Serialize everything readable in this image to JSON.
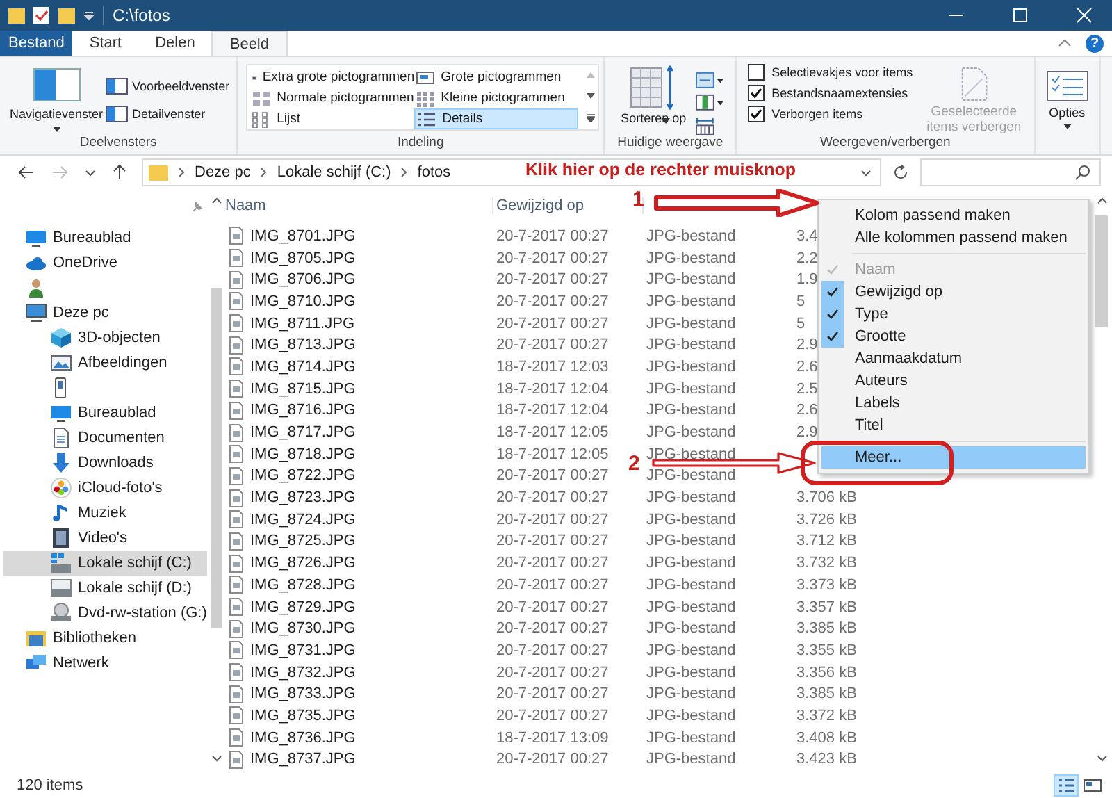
{
  "window": {
    "title": "C:\\fotos"
  },
  "ribbon_tabs": [
    {
      "label": "Bestand",
      "kind": "file",
      "selected": false
    },
    {
      "label": "Start",
      "kind": "tab",
      "selected": false
    },
    {
      "label": "Delen",
      "kind": "tab",
      "selected": false
    },
    {
      "label": "Beeld",
      "kind": "tab",
      "selected": true
    }
  ],
  "help": "?",
  "ribbon": {
    "panes": {
      "label": "Deelvensters",
      "navigation": "Navigatievenster",
      "preview": "Voorbeeldvenster",
      "details": "Detailvenster"
    },
    "layout": {
      "label": "Indeling",
      "options": [
        {
          "label": "Extra grote pictogrammen",
          "kind": "xl",
          "selected": false
        },
        {
          "label": "Grote pictogrammen",
          "kind": "large",
          "selected": false
        },
        {
          "label": "Normale pictogrammen",
          "kind": "medium",
          "selected": false
        },
        {
          "label": "Kleine pictogrammen",
          "kind": "small",
          "selected": false
        },
        {
          "label": "Lijst",
          "kind": "list",
          "selected": false
        },
        {
          "label": "Details",
          "kind": "details",
          "selected": true
        }
      ]
    },
    "current_view": {
      "label": "Huidige weergave",
      "sort": "Sorteren op"
    },
    "show_hide": {
      "label": "Weergeven/verbergen",
      "options": [
        {
          "label": "Selectievakjes voor items",
          "checked": false
        },
        {
          "label": "Bestandsnaamextensies",
          "checked": true
        },
        {
          "label": "Verborgen items",
          "checked": true
        }
      ],
      "hide_selected": {
        "label": "Geselecteerde items verbergen",
        "disabled": true
      }
    },
    "options": "Opties"
  },
  "address": {
    "breadcrumbs": [
      "Deze pc",
      "Lokale schijf (C:)",
      "fotos"
    ]
  },
  "annotation": {
    "instruction": "Klik hier op de rechter muisknop",
    "step_1": "1",
    "step_2": "2"
  },
  "navigation": [
    {
      "kind": "desktop",
      "label": "Bureaublad",
      "selected": false
    },
    {
      "kind": "cloud",
      "label": "OneDrive",
      "selected": false
    },
    {
      "kind": "user",
      "selected": false
    },
    {
      "kind": "pc",
      "label": "Deze pc",
      "selected": false,
      "children": [
        {
          "kind": "cube",
          "label": "3D-objecten",
          "selected": false
        },
        {
          "kind": "pictures",
          "label": "Afbeeldingen",
          "selected": false
        },
        {
          "kind": "phone",
          "selected": false
        },
        {
          "kind": "desktop",
          "label": "Bureaublad",
          "selected": false
        },
        {
          "kind": "documents",
          "label": "Documenten",
          "selected": false
        },
        {
          "kind": "downloads",
          "label": "Downloads",
          "selected": false
        },
        {
          "kind": "photos",
          "label": "iCloud-foto's",
          "selected": false
        },
        {
          "kind": "music",
          "label": "Muziek",
          "selected": false
        },
        {
          "kind": "video",
          "label": "Video's",
          "selected": false
        },
        {
          "kind": "system",
          "label": "Lokale schijf (C:)",
          "selected": true
        },
        {
          "kind": "drive",
          "label": "Lokale schijf (D:)",
          "selected": false
        },
        {
          "kind": "dvd",
          "label": "Dvd-rw-station (G:)",
          "selected": false
        }
      ]
    },
    {
      "kind": "library",
      "label": "Bibliotheken",
      "selected": false
    },
    {
      "kind": "network",
      "label": "Netwerk",
      "selected": false
    }
  ],
  "table": {
    "columns": [
      "Naam",
      "Gewijzigd op"
    ],
    "rows": [
      [
        "IMG_8701.JPG",
        "20-7-2017 00:27",
        "JPG-bestand",
        "3.4"
      ],
      [
        "IMG_8705.JPG",
        "20-7-2017 00:27",
        "JPG-bestand",
        "2.2"
      ],
      [
        "IMG_8706.JPG",
        "20-7-2017 00:27",
        "JPG-bestand",
        "1.9"
      ],
      [
        "IMG_8710.JPG",
        "20-7-2017 00:27",
        "JPG-bestand",
        "5"
      ],
      [
        "IMG_8711.JPG",
        "20-7-2017 00:27",
        "JPG-bestand",
        "5"
      ],
      [
        "IMG_8713.JPG",
        "20-7-2017 00:27",
        "JPG-bestand",
        "2.9"
      ],
      [
        "IMG_8714.JPG",
        "18-7-2017 12:03",
        "JPG-bestand",
        "2.6"
      ],
      [
        "IMG_8715.JPG",
        "18-7-2017 12:04",
        "JPG-bestand",
        "2.5"
      ],
      [
        "IMG_8716.JPG",
        "18-7-2017 12:04",
        "JPG-bestand",
        "2.6"
      ],
      [
        "IMG_8717.JPG",
        "18-7-2017 12:05",
        "JPG-bestand",
        "2.9"
      ],
      [
        "IMG_8718.JPG",
        "18-7-2017 12:05",
        "JPG-bestand"
      ],
      [
        "IMG_8722.JPG",
        "20-7-2017 00:27",
        "JPG-bestand"
      ],
      [
        "IMG_8723.JPG",
        "20-7-2017 00:27",
        "JPG-bestand",
        "3.706 kB"
      ],
      [
        "IMG_8724.JPG",
        "20-7-2017 00:27",
        "JPG-bestand",
        "3.726 kB"
      ],
      [
        "IMG_8725.JPG",
        "20-7-2017 00:27",
        "JPG-bestand",
        "3.712 kB"
      ],
      [
        "IMG_8726.JPG",
        "20-7-2017 00:27",
        "JPG-bestand",
        "3.732 kB"
      ],
      [
        "IMG_8728.JPG",
        "20-7-2017 00:27",
        "JPG-bestand",
        "3.373 kB"
      ],
      [
        "IMG_8729.JPG",
        "20-7-2017 00:27",
        "JPG-bestand",
        "3.357 kB"
      ],
      [
        "IMG_8730.JPG",
        "20-7-2017 00:27",
        "JPG-bestand",
        "3.385 kB"
      ],
      [
        "IMG_8731.JPG",
        "20-7-2017 00:27",
        "JPG-bestand",
        "3.355 kB"
      ],
      [
        "IMG_8732.JPG",
        "20-7-2017 00:27",
        "JPG-bestand",
        "3.356 kB"
      ],
      [
        "IMG_8733.JPG",
        "20-7-2017 00:27",
        "JPG-bestand",
        "3.385 kB"
      ],
      [
        "IMG_8735.JPG",
        "20-7-2017 00:27",
        "JPG-bestand",
        "3.372 kB"
      ],
      [
        "IMG_8736.JPG",
        "18-7-2017 13:09",
        "JPG-bestand",
        "3.408 kB"
      ],
      [
        "IMG_8737.JPG",
        "20-7-2017 00:27",
        "JPG-bestand",
        "3.423 kB"
      ]
    ]
  },
  "context_menu": [
    {
      "items": [
        {
          "label": "Kolom passend maken",
          "checked": false,
          "disabled": false,
          "selected": false
        },
        {
          "label": "Alle kolommen passend maken",
          "checked": false,
          "disabled": false,
          "selected": false
        }
      ]
    },
    {
      "items": [
        {
          "label": "Naam",
          "checked": true,
          "disabled": true,
          "selected": false
        },
        {
          "label": "Gewijzigd op",
          "checked": true,
          "disabled": false,
          "selected": false
        },
        {
          "label": "Type",
          "checked": true,
          "disabled": false,
          "selected": false
        },
        {
          "label": "Grootte",
          "checked": true,
          "disabled": false,
          "selected": false
        },
        {
          "label": "Aanmaakdatum",
          "checked": false,
          "disabled": false,
          "selected": false
        },
        {
          "label": "Auteurs",
          "checked": false,
          "disabled": false,
          "selected": false
        },
        {
          "label": "Labels",
          "checked": false,
          "disabled": false,
          "selected": false
        },
        {
          "label": "Titel",
          "checked": false,
          "disabled": false,
          "selected": false
        }
      ]
    },
    {
      "items": [
        {
          "label": "Meer...",
          "checked": false,
          "disabled": false,
          "selected": true
        }
      ]
    }
  ],
  "status_bar": {
    "count": "120 items",
    "views": [
      {
        "kind": "details",
        "selected": true
      },
      {
        "kind": "tiles",
        "selected": false
      }
    ]
  }
}
